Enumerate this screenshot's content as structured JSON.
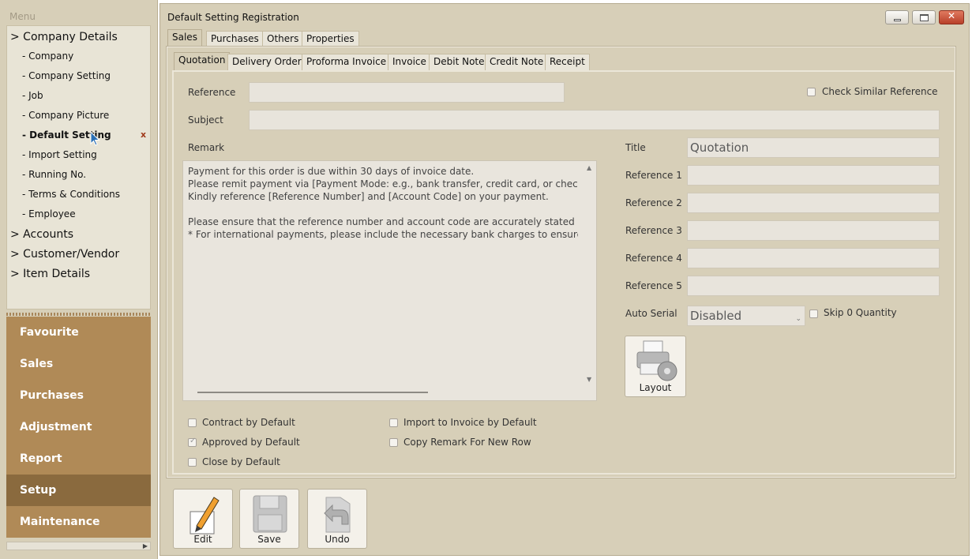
{
  "menu": {
    "title": "Menu",
    "tree": [
      {
        "label": "> Company Details",
        "type": "group"
      },
      {
        "label": "- Company",
        "type": "sub"
      },
      {
        "label": "- Company Setting",
        "type": "sub"
      },
      {
        "label": "- Job",
        "type": "sub"
      },
      {
        "label": "- Company Picture",
        "type": "sub"
      },
      {
        "label": "- Default Setting",
        "type": "sub",
        "active": true
      },
      {
        "label": "- Import Setting",
        "type": "sub"
      },
      {
        "label": "- Running No.",
        "type": "sub"
      },
      {
        "label": "- Terms & Conditions",
        "type": "sub"
      },
      {
        "label": "- Employee",
        "type": "sub"
      },
      {
        "label": "> Accounts",
        "type": "group"
      },
      {
        "label": "> Customer/Vendor",
        "type": "group"
      },
      {
        "label": "> Item Details",
        "type": "group"
      }
    ],
    "close_mark": "x",
    "modules": [
      "Favourite",
      "Sales",
      "Purchases",
      "Adjustment",
      "Report",
      "Setup",
      "Maintenance"
    ],
    "active_module": "Setup"
  },
  "window": {
    "title": "Default Setting Registration",
    "top_tabs": [
      "Sales",
      "Purchases",
      "Others",
      "Properties"
    ],
    "active_top_tab": "Sales",
    "doc_tabs": [
      "Quotation",
      "Delivery Order",
      "Proforma Invoice",
      "Invoice",
      "Debit Note",
      "Credit Note",
      "Receipt"
    ],
    "active_doc_tab": "Quotation"
  },
  "form": {
    "reference_label": "Reference",
    "reference_value": "",
    "check_similar_label": "Check Similar Reference",
    "subject_label": "Subject",
    "subject_value": "",
    "remark_label": "Remark",
    "remark_text": "Payment for this order is due within 30 days of invoice date.\nPlease remit payment via [Payment Mode: e.g., bank transfer, credit card, or check] to\nKindly reference [Reference Number] and [Account Code] on your payment.\n\nPlease ensure that the reference number and account code are accurately stated on al\n* For international payments, please include the necessary bank charges to ensure the",
    "title_label": "Title",
    "title_value": "Quotation",
    "ref1_label": "Reference 1",
    "ref2_label": "Reference 2",
    "ref3_label": "Reference 3",
    "ref4_label": "Reference 4",
    "ref5_label": "Reference 5",
    "auto_serial_label": "Auto Serial",
    "auto_serial_value": "Disabled",
    "skip_zero_label": "Skip 0 Quantity",
    "layout_label": "Layout",
    "contract_default_label": "Contract by Default",
    "approved_default_label": "Approved by Default",
    "close_default_label": "Close by Default",
    "import_invoice_label": "Import to Invoice by Default",
    "copy_remark_label": "Copy Remark For New Row",
    "approved_checked": true
  },
  "toolbar": {
    "edit_label": "Edit",
    "save_label": "Save",
    "undo_label": "Undo"
  }
}
